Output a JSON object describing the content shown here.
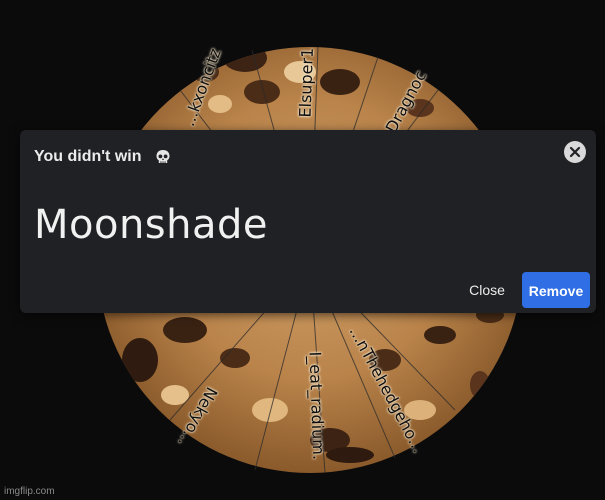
{
  "wheel": {
    "labels": [
      "...kxoncitz",
      "Elsuper1",
      "Dragnoc",
      "...nThehedgeho...",
      "I_eat_radium.",
      "Nekyo..."
    ]
  },
  "dialog": {
    "title": "You didn't win",
    "title_icon": "skull-icon",
    "winner": "Moonshade",
    "close_label": "Close",
    "remove_label": "Remove",
    "accent_color": "#2f6ee5",
    "background_color": "#202124"
  },
  "watermark": "imgflip.com"
}
